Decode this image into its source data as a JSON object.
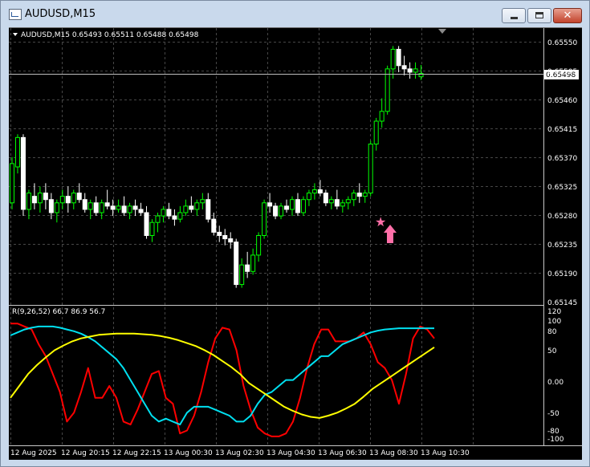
{
  "window": {
    "title": "AUDUSD,M15",
    "buttons": {
      "minimize": "minimize",
      "maximize": "maximize",
      "close": "✕"
    }
  },
  "colors": {
    "background": "#000000",
    "grid": "#808080",
    "bull_candle": "#00ff00",
    "bear_candle": "#ffffff",
    "rsi_fast": "#ff0000",
    "rsi_mid": "#00e0f0",
    "rsi_slow": "#ffff00",
    "signal": "#ff6fa8"
  },
  "main_chart": {
    "header": "AUDUSD,M15  0.65493 0.65511 0.65488 0.65498",
    "current_price": "0.65498",
    "price_labels": [
      "0.65550",
      "0.65505",
      "0.65460",
      "0.65415",
      "0.65370",
      "0.65325",
      "0.65280",
      "0.65235",
      "0.65190",
      "0.65145"
    ]
  },
  "sub_chart": {
    "header": "R(9,26,52) 66.7 86.9 56.7",
    "level_labels": [
      "120",
      "100",
      "80",
      "50",
      "0.00",
      "-50",
      "-80",
      "-100"
    ]
  },
  "time_labels": [
    "12 Aug 2025",
    "12 Aug 20:15",
    "12 Aug 22:15",
    "13 Aug 00:30",
    "13 Aug 02:30",
    "13 Aug 04:30",
    "13 Aug 06:30",
    "13 Aug 08:30",
    "13 Aug 10:30"
  ],
  "chart_data": [
    {
      "type": "candlestick",
      "title": "AUDUSD,M15",
      "ylim": [
        0.65145,
        0.65565
      ],
      "ohlc": [
        [
          0.653,
          0.6537,
          0.6529,
          0.6536
        ],
        [
          0.65355,
          0.65405,
          0.65345,
          0.654
        ],
        [
          0.654,
          0.65405,
          0.6528,
          0.6529
        ],
        [
          0.6529,
          0.6532,
          0.65275,
          0.65315
        ],
        [
          0.6531,
          0.6533,
          0.6529,
          0.653
        ],
        [
          0.653,
          0.65325,
          0.65285,
          0.65315
        ],
        [
          0.65315,
          0.6533,
          0.6529,
          0.65305
        ],
        [
          0.65305,
          0.65315,
          0.65275,
          0.65285
        ],
        [
          0.65285,
          0.65305,
          0.6527,
          0.653
        ],
        [
          0.653,
          0.6532,
          0.6529,
          0.6531
        ],
        [
          0.6531,
          0.65325,
          0.65285,
          0.653
        ],
        [
          0.653,
          0.6532,
          0.6529,
          0.65315
        ],
        [
          0.65315,
          0.6533,
          0.653,
          0.65305
        ],
        [
          0.65305,
          0.65315,
          0.65285,
          0.6529
        ],
        [
          0.6529,
          0.65305,
          0.65275,
          0.653
        ],
        [
          0.653,
          0.6531,
          0.6528,
          0.65285
        ],
        [
          0.65285,
          0.65305,
          0.65275,
          0.653
        ],
        [
          0.653,
          0.6532,
          0.6529,
          0.65295
        ],
        [
          0.65295,
          0.65305,
          0.6528,
          0.6529
        ],
        [
          0.6529,
          0.65305,
          0.65285,
          0.65295
        ],
        [
          0.65295,
          0.6531,
          0.6528,
          0.65285
        ],
        [
          0.65285,
          0.653,
          0.65275,
          0.65295
        ],
        [
          0.65295,
          0.65305,
          0.6528,
          0.6529
        ],
        [
          0.6529,
          0.653,
          0.6528,
          0.65285
        ],
        [
          0.65285,
          0.65295,
          0.65245,
          0.6525
        ],
        [
          0.6525,
          0.65275,
          0.6524,
          0.6527
        ],
        [
          0.6527,
          0.65285,
          0.65255,
          0.6528
        ],
        [
          0.6528,
          0.65295,
          0.6527,
          0.6529
        ],
        [
          0.6529,
          0.653,
          0.65275,
          0.6528
        ],
        [
          0.6528,
          0.6529,
          0.65265,
          0.65275
        ],
        [
          0.65275,
          0.65295,
          0.6527,
          0.65285
        ],
        [
          0.65285,
          0.65305,
          0.6528,
          0.65295
        ],
        [
          0.65295,
          0.6531,
          0.65285,
          0.6529
        ],
        [
          0.6529,
          0.65305,
          0.6528,
          0.653
        ],
        [
          0.653,
          0.65315,
          0.6529,
          0.65305
        ],
        [
          0.65305,
          0.65315,
          0.6527,
          0.65275
        ],
        [
          0.65275,
          0.65285,
          0.6525,
          0.65255
        ],
        [
          0.65255,
          0.65265,
          0.6524,
          0.6525
        ],
        [
          0.6525,
          0.6526,
          0.65235,
          0.65245
        ],
        [
          0.65245,
          0.65255,
          0.6523,
          0.6524
        ],
        [
          0.6524,
          0.65245,
          0.6517,
          0.65175
        ],
        [
          0.65175,
          0.65215,
          0.6517,
          0.65205
        ],
        [
          0.65205,
          0.65225,
          0.65185,
          0.65195
        ],
        [
          0.65195,
          0.6523,
          0.6519,
          0.6522
        ],
        [
          0.6522,
          0.65255,
          0.6521,
          0.6525
        ],
        [
          0.6525,
          0.65305,
          0.65245,
          0.653
        ],
        [
          0.653,
          0.65315,
          0.65285,
          0.65295
        ],
        [
          0.65295,
          0.653,
          0.65275,
          0.6528
        ],
        [
          0.6528,
          0.653,
          0.65275,
          0.65295
        ],
        [
          0.65295,
          0.65305,
          0.65285,
          0.6529
        ],
        [
          0.6529,
          0.6531,
          0.6528,
          0.65305
        ],
        [
          0.65305,
          0.65315,
          0.6528,
          0.65285
        ],
        [
          0.65285,
          0.6531,
          0.6528,
          0.65305
        ],
        [
          0.65305,
          0.6532,
          0.65295,
          0.65315
        ],
        [
          0.65315,
          0.6533,
          0.65305,
          0.6532
        ],
        [
          0.6532,
          0.65335,
          0.6531,
          0.65315
        ],
        [
          0.65315,
          0.6532,
          0.65295,
          0.653
        ],
        [
          0.653,
          0.6531,
          0.6529,
          0.65305
        ],
        [
          0.65305,
          0.6532,
          0.6529,
          0.65295
        ],
        [
          0.65295,
          0.65305,
          0.65285,
          0.653
        ],
        [
          0.653,
          0.6531,
          0.6529,
          0.65305
        ],
        [
          0.65305,
          0.6532,
          0.65295,
          0.65315
        ],
        [
          0.65315,
          0.6533,
          0.653,
          0.6531
        ],
        [
          0.6531,
          0.6532,
          0.653,
          0.65315
        ],
        [
          0.65315,
          0.65395,
          0.6531,
          0.6539
        ],
        [
          0.6539,
          0.6543,
          0.6538,
          0.65425
        ],
        [
          0.65425,
          0.6546,
          0.65415,
          0.6544
        ],
        [
          0.6544,
          0.6551,
          0.65435,
          0.65505
        ],
        [
          0.65505,
          0.6554,
          0.6549,
          0.65535
        ],
        [
          0.65535,
          0.6554,
          0.655,
          0.6551
        ],
        [
          0.6551,
          0.65525,
          0.65495,
          0.65505
        ],
        [
          0.65505,
          0.65515,
          0.6549,
          0.655
        ],
        [
          0.655,
          0.65515,
          0.6549,
          0.65505
        ],
        [
          0.65493,
          0.65511,
          0.65488,
          0.65498
        ]
      ]
    },
    {
      "type": "line",
      "title": "R(9,26,52) 66.7 86.9 56.7",
      "ylim": [
        -110,
        125
      ],
      "series": [
        {
          "values": [
            95,
            95,
            90,
            85,
            60,
            40,
            10,
            -20,
            -70,
            -55,
            -20,
            20,
            -30,
            -30,
            -10,
            -30,
            -70,
            -75,
            -50,
            -20,
            10,
            15,
            -30,
            -40,
            -90,
            -85,
            -60,
            -20,
            30,
            70,
            88,
            85,
            50,
            -10,
            -50,
            -80,
            -90,
            -95,
            -95,
            -90,
            -70,
            -30,
            20,
            60,
            85,
            85,
            65,
            65,
            65,
            70,
            80,
            60,
            30,
            20,
            0,
            -40,
            10,
            70,
            90,
            85,
            70
          ]
        },
        {
          "values": [
            75,
            80,
            85,
            88,
            90,
            90,
            90,
            88,
            85,
            82,
            78,
            72,
            65,
            55,
            45,
            35,
            20,
            0,
            -20,
            -40,
            -60,
            -70,
            -65,
            -70,
            -75,
            -55,
            -45,
            -45,
            -45,
            -50,
            -55,
            -60,
            -70,
            -70,
            -60,
            -40,
            -25,
            -20,
            -10,
            0,
            0,
            10,
            20,
            30,
            40,
            40,
            50,
            60,
            65,
            70,
            75,
            80,
            83,
            85,
            86,
            87,
            87,
            87,
            87,
            87,
            87
          ]
        },
        {
          "values": [
            -30,
            -10,
            10,
            25,
            38,
            50,
            58,
            65,
            70,
            73,
            76,
            77,
            78,
            78,
            78,
            77,
            76,
            74,
            71,
            67,
            62,
            57,
            50,
            42,
            32,
            22,
            10,
            -5,
            -15,
            -25,
            -35,
            -45,
            -52,
            -58,
            -62,
            -64,
            -60,
            -55,
            -48,
            -40,
            -28,
            -15,
            -5,
            5,
            15,
            25,
            35,
            45,
            55
          ]
        }
      ]
    }
  ]
}
